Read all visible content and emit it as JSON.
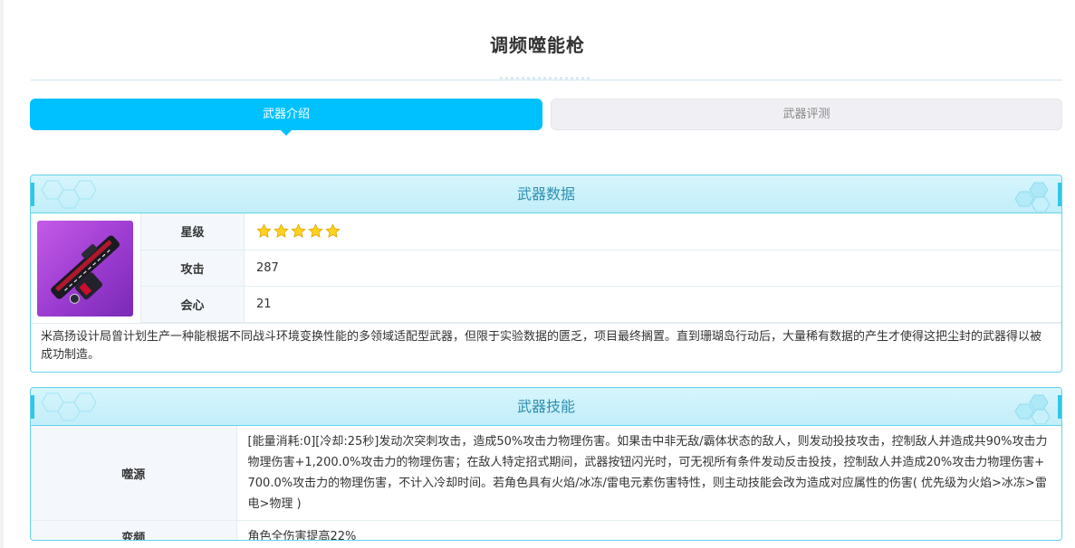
{
  "page": {
    "title": "调频噬能枪"
  },
  "tabs": {
    "intro": "武器介绍",
    "review": "武器评测"
  },
  "weapon_data": {
    "heading": "武器数据",
    "image_icon": "weapon-gun-icon",
    "rows": [
      {
        "label": "星级",
        "value": "",
        "stars": 5
      },
      {
        "label": "攻击",
        "value": "287"
      },
      {
        "label": "会心",
        "value": "21"
      }
    ],
    "description": "米高扬设计局曾计划生产一种能根据不同战斗环境变换性能的多领域适配型武器，但限于实验数据的匮乏，项目最终搁置。直到珊瑚岛行动后，大量稀有数据的产生才使得这把尘封的武器得以被成功制造。"
  },
  "weapon_skills": {
    "heading": "武器技能",
    "rows": [
      {
        "label": "噬源",
        "value": "[能量消耗:0][冷却:25秒]发动次突刺攻击，造成50%攻击力物理伤害。如果击中非无敌/霸体状态的敌人，则发动投技攻击，控制敌人并造成共90%攻击力物理伤害+1,200.0%攻击力的物理伤害；在敌人特定招式期间，武器按钮闪光时，可无视所有条件发动反击投技，控制敌人并造成20%攻击力物理伤害+ 700.0%攻击力的物理伤害，不计入冷却时间。若角色具有火焰/冰冻/雷电元素伤害特性，则主动技能会改为造成对应属性的伤害( 优先级为火焰>冰冻>雷电>物理 )"
      },
      {
        "label": "变频",
        "value": "角色全伤害提高22%"
      }
    ]
  },
  "colors": {
    "accent": "#00c1ff",
    "panel_border": "#63d3e8",
    "panel_head": "#c8f0fb",
    "heading_text": "#2f8fb0"
  }
}
